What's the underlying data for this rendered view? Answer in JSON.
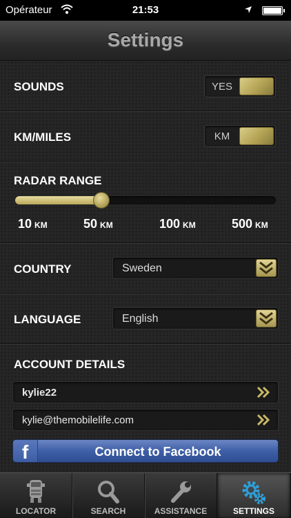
{
  "status_bar": {
    "carrier": "Opérateur",
    "time": "21:53"
  },
  "nav": {
    "title": "Settings"
  },
  "settings": {
    "sounds": {
      "label": "SOUNDS",
      "value": "YES"
    },
    "units": {
      "label": "KM/MILES",
      "value": "KM"
    },
    "radar": {
      "label": "RADAR RANGE",
      "selected_fraction": 0.33,
      "ticks": [
        {
          "value": "10",
          "unit": "KM"
        },
        {
          "value": "50",
          "unit": "KM"
        },
        {
          "value": "100",
          "unit": "KM"
        },
        {
          "value": "500",
          "unit": "KM"
        }
      ]
    },
    "country": {
      "label": "COUNTRY",
      "value": "Sweden"
    },
    "language": {
      "label": "LANGUAGE",
      "value": "English"
    },
    "account": {
      "label": "ACCOUNT DETAILS",
      "username": "kylie22",
      "email": "kylie@themobilelife.com",
      "facebook_button": "Connect to Facebook",
      "facebook_logo": "f"
    }
  },
  "tabs": [
    {
      "label": "LOCATOR",
      "icon": "truck-icon",
      "active": false
    },
    {
      "label": "SEARCH",
      "icon": "search-icon",
      "active": false
    },
    {
      "label": "ASSISTANCE",
      "icon": "wrench-icon",
      "active": false
    },
    {
      "label": "SETTINGS",
      "icon": "gears-icon",
      "active": true
    }
  ],
  "colors": {
    "accent_gold": "#b9a95a",
    "facebook_blue": "#3f5fa6",
    "active_icon": "#2e9fd8"
  }
}
